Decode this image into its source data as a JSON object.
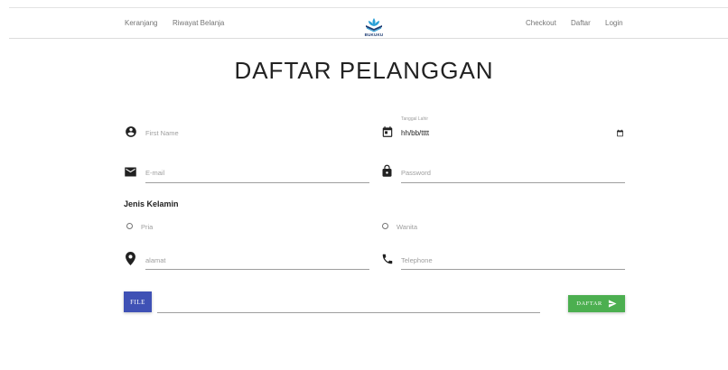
{
  "nav": {
    "left": [
      "Keranjang",
      "Riwayat Belanja"
    ],
    "right": [
      "Checkout",
      "Daftar",
      "Login"
    ],
    "logo_text": "BUKUKU"
  },
  "page": {
    "title": "DAFTAR PELANGGAN"
  },
  "form": {
    "first_name": {
      "placeholder": "First Name",
      "icon": "account-circle-icon"
    },
    "birth_date": {
      "label": "Tanggal Lahir",
      "value": "hh/bb/tttt",
      "icon": "calendar-icon"
    },
    "email": {
      "placeholder": "E-mail",
      "icon": "email-icon"
    },
    "password": {
      "placeholder": "Password",
      "icon": "lock-icon"
    },
    "gender": {
      "label": "Jenis Kelamin",
      "options": [
        "Pria",
        "Wanita"
      ]
    },
    "address": {
      "placeholder": "alamat",
      "icon": "location-pin-icon"
    },
    "phone": {
      "placeholder": "Telephone",
      "icon": "phone-icon"
    },
    "file_button": "FILE",
    "submit_button": "DAFTAR"
  },
  "colors": {
    "file_button": "#3f51b5",
    "submit_button": "#4caf50"
  }
}
